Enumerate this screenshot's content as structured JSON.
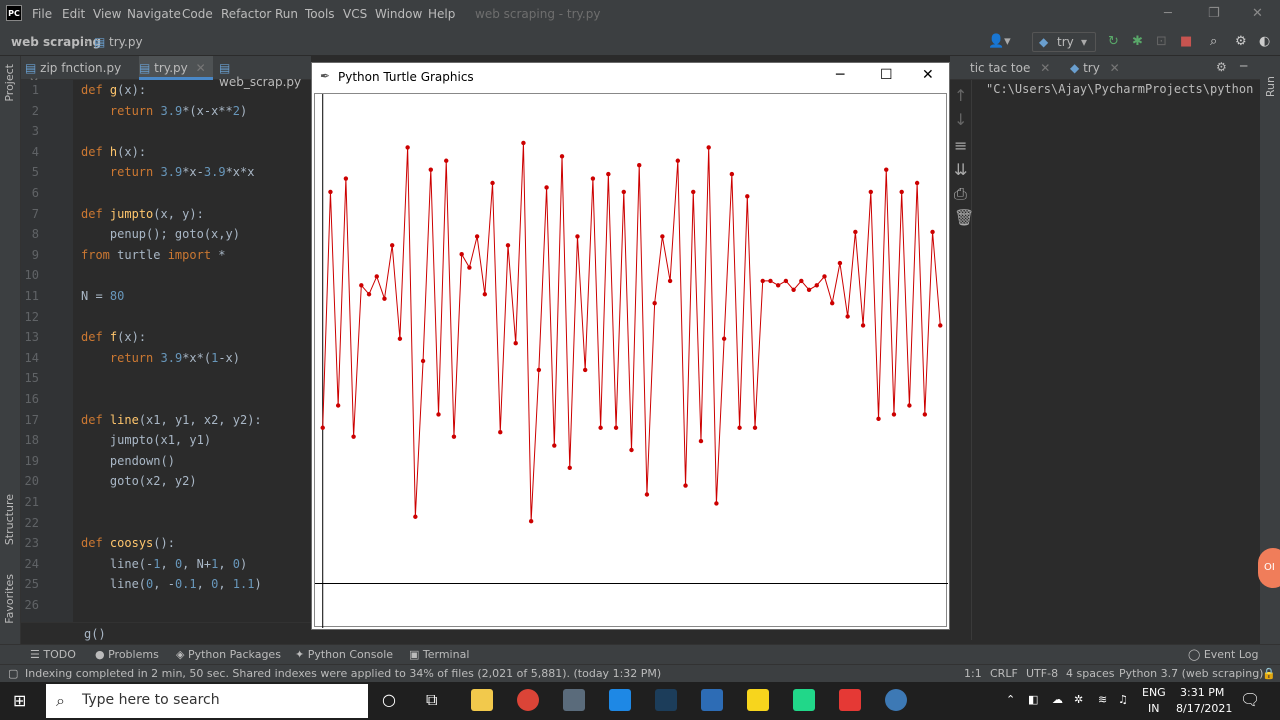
{
  "menubar": {
    "logo": "PC",
    "items": [
      "File",
      "Edit",
      "View",
      "Navigate",
      "Code",
      "Refactor",
      "Run",
      "Tools",
      "VCS",
      "Window",
      "Help"
    ],
    "window_title": "web scraping - try.py"
  },
  "navbar": {
    "project": "web scraping",
    "file": "try.py",
    "run_config": "try"
  },
  "left_strip": {
    "project": "Project",
    "structure": "Structure",
    "favorites": "Favorites"
  },
  "editor": {
    "tabs": [
      "zip fnction.py",
      "try.py",
      "web_scrap.py"
    ],
    "lines": [
      {
        "n": "1",
        "t": "def g(x):"
      },
      {
        "n": "2",
        "t": "    return 3.9*(x-x**2)"
      },
      {
        "n": "3",
        "t": ""
      },
      {
        "n": "4",
        "t": "def h(x):"
      },
      {
        "n": "5",
        "t": "    return 3.9*x-3.9*x*x"
      },
      {
        "n": "6",
        "t": ""
      },
      {
        "n": "7",
        "t": "def jumpto(x, y):"
      },
      {
        "n": "8",
        "t": "    penup(); goto(x,y)"
      },
      {
        "n": "9",
        "t": "from turtle import *"
      },
      {
        "n": "10",
        "t": ""
      },
      {
        "n": "11",
        "t": "N = 80"
      },
      {
        "n": "12",
        "t": ""
      },
      {
        "n": "13",
        "t": "def f(x):"
      },
      {
        "n": "14",
        "t": "    return 3.9*x*(1-x)"
      },
      {
        "n": "15",
        "t": ""
      },
      {
        "n": "16",
        "t": ""
      },
      {
        "n": "17",
        "t": "def line(x1, y1, x2, y2):"
      },
      {
        "n": "18",
        "t": "    jumpto(x1, y1)"
      },
      {
        "n": "19",
        "t": "    pendown()"
      },
      {
        "n": "20",
        "t": "    goto(x2, y2)"
      },
      {
        "n": "21",
        "t": ""
      },
      {
        "n": "22",
        "t": ""
      },
      {
        "n": "23",
        "t": "def coosys():"
      },
      {
        "n": "24",
        "t": "    line(-1, 0, N+1, 0)"
      },
      {
        "n": "25",
        "t": "    line(0, -0.1, 0, 1.1)"
      },
      {
        "n": "26",
        "t": ""
      }
    ],
    "breadcrumb_fn": "g()"
  },
  "turtle_window": {
    "title": "Python Turtle Graphics",
    "colors": {
      "f": "#cc0000",
      "g": "#0000cc",
      "h": "#006600"
    }
  },
  "chart_data": {
    "type": "line",
    "xlim": [
      -1,
      81
    ],
    "ylim": [
      -0.1,
      1.1
    ],
    "x": "0..80 (iteration index)",
    "series": [
      {
        "color": "#cc0000",
        "values": [
          0.35,
          0.88,
          0.4,
          0.91,
          0.33,
          0.67,
          0.65,
          0.69,
          0.64,
          0.76,
          0.55,
          0.98,
          0.15,
          0.5,
          0.93,
          0.38,
          0.95,
          0.33,
          0.74,
          0.71,
          0.78,
          0.65,
          0.9,
          0.34,
          0.76,
          0.54,
          0.99,
          0.14,
          0.48,
          0.89,
          0.31,
          0.96,
          0.26,
          0.78,
          0.48,
          0.91,
          0.35,
          0.92,
          0.35,
          0.88,
          0.3,
          0.94,
          0.2,
          0.63,
          0.78,
          0.68,
          0.95,
          0.22,
          0.88,
          0.32,
          0.98,
          0.18,
          0.55,
          0.92,
          0.35,
          0.87,
          0.35,
          0.68,
          0.68,
          0.67,
          0.68,
          0.66,
          0.68,
          0.66,
          0.67,
          0.69,
          0.63,
          0.72,
          0.6,
          0.79,
          0.58,
          0.88,
          0.37,
          0.93,
          0.38,
          0.88,
          0.4,
          0.9,
          0.38,
          0.79,
          0.58
        ]
      }
    ]
  },
  "right_panel": {
    "tabs": [
      "tic tac toe",
      "try"
    ],
    "console_text": "\"C:\\Users\\Ajay\\PycharmProjects\\python",
    "run_label": "Run",
    "badge": "OI"
  },
  "tool_window_bar": [
    "TODO",
    "Problems",
    "Python Packages",
    "Python Console",
    "Terminal",
    "Event Log"
  ],
  "status": {
    "message": "Indexing completed in 2 min, 50 sec. Shared indexes were applied to 34% of files (2,021 of 5,881). (today 1:32 PM)",
    "position": "1:1",
    "line_sep": "CRLF",
    "encoding": "UTF-8",
    "indent": "4 spaces",
    "interpreter": "Python 3.7 (web scraping)"
  },
  "taskbar": {
    "search_placeholder": "Type here to search",
    "lang": "ENG",
    "region": "IN",
    "time": "3:31 PM",
    "date": "8/17/2021"
  }
}
